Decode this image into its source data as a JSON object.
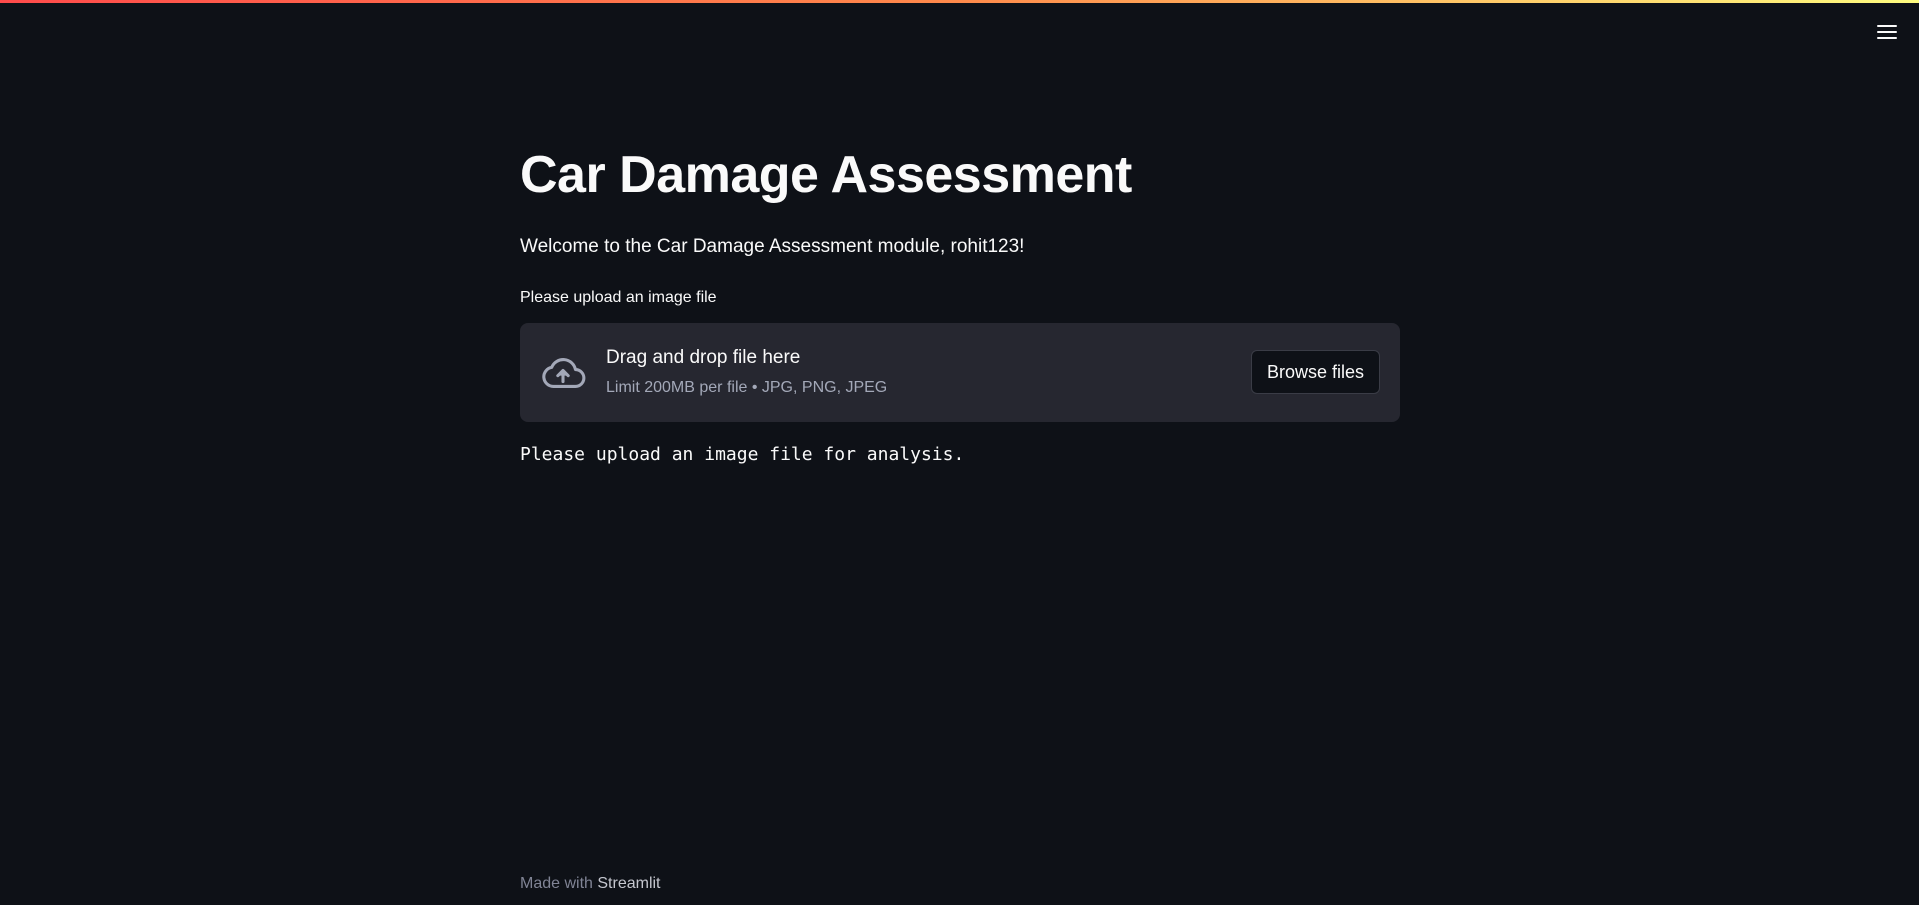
{
  "header": {
    "menu_icon": "hamburger-menu-icon",
    "accent_gradient": [
      "#ff4b4b",
      "#fffd80"
    ]
  },
  "main": {
    "title": "Car Damage Assessment",
    "welcome": "Welcome to the Car Damage Assessment module, rohit123!",
    "upload_label": "Please upload an image file",
    "dropzone": {
      "icon": "cloud-upload-icon",
      "main_text": "Drag and drop file here",
      "sub_text": "Limit 200MB per file • JPG, PNG, JPEG",
      "browse_label": "Browse files"
    },
    "status_message": "Please upload an image file for analysis."
  },
  "footer": {
    "made_with": "Made with",
    "link_text": "Streamlit"
  },
  "colors": {
    "background": "#0e1117",
    "dropzone_bg": "#262730",
    "text": "#fafafa",
    "muted_text": "#a3a8b8"
  }
}
